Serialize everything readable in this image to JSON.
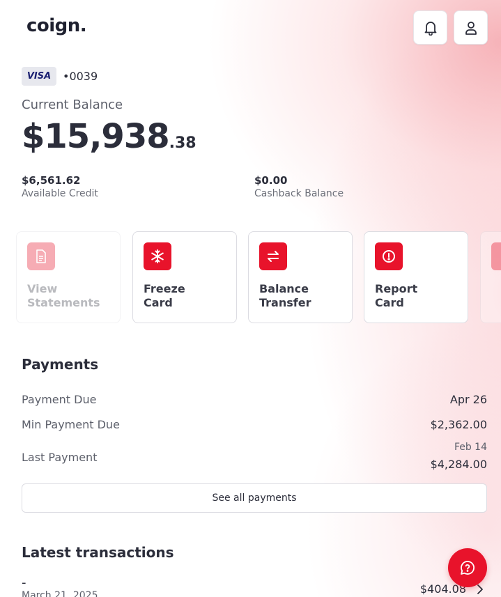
{
  "brand": {
    "logo_text": "coign.",
    "accent_color": "#e8132b"
  },
  "header": {
    "notifications_icon": "bell-icon",
    "profile_icon": "user-icon"
  },
  "card": {
    "network_label": "VISA",
    "last_digits": "•0039"
  },
  "balance": {
    "label": "Current Balance",
    "amount_main": "$15,938",
    "amount_cents": ".38",
    "available_credit_value": "$6,561.62",
    "available_credit_label": "Available Credit",
    "cashback_value": "$0.00",
    "cashback_label": "Cashback Balance"
  },
  "actions": [
    {
      "line1": "View",
      "line2": "Statements",
      "icon": "document-icon"
    },
    {
      "line1": "Freeze",
      "line2": "Card",
      "icon": "snowflake-icon"
    },
    {
      "line1": "Balance",
      "line2": "Transfer",
      "icon": "transfer-arrows-icon"
    },
    {
      "line1": "Report",
      "line2": "Card",
      "icon": "alert-circle-icon"
    }
  ],
  "payments": {
    "title": "Payments",
    "payment_due_label": "Payment Due",
    "payment_due_value": "Apr 26",
    "min_payment_label": "Min Payment Due",
    "min_payment_value": "$2,362.00",
    "last_payment_label": "Last Payment",
    "last_payment_date": "Feb 14",
    "last_payment_value": "$4,284.00",
    "see_all_label": "See all payments"
  },
  "transactions": {
    "title": "Latest transactions",
    "items": [
      {
        "description": "-",
        "date": "March 21, 2025",
        "amount": "$404.08"
      }
    ]
  },
  "help": {
    "icon": "help-chat-icon"
  }
}
